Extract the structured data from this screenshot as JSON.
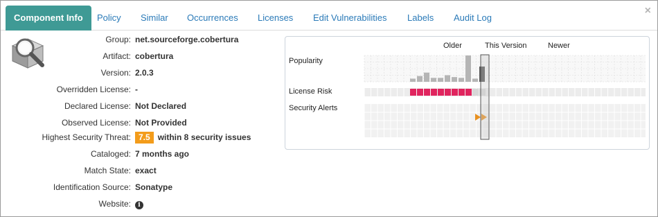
{
  "tabs": [
    {
      "label": "Component Info",
      "active": true
    },
    {
      "label": "Policy"
    },
    {
      "label": "Similar"
    },
    {
      "label": "Occurrences"
    },
    {
      "label": "Licenses"
    },
    {
      "label": "Edit Vulnerabilities"
    },
    {
      "label": "Labels"
    },
    {
      "label": "Audit Log"
    }
  ],
  "close_label": "×",
  "info": {
    "group": {
      "label": "Group:",
      "value": "net.sourceforge.cobertura"
    },
    "artifact": {
      "label": "Artifact:",
      "value": "cobertura"
    },
    "version": {
      "label": "Version:",
      "value": "2.0.3"
    },
    "overridden_license": {
      "label": "Overridden License:",
      "value": "-"
    },
    "declared_license": {
      "label": "Declared License:",
      "value": "Not Declared"
    },
    "observed_license": {
      "label": "Observed License:",
      "value": "Not Provided"
    },
    "highest_threat": {
      "label": "Highest Security Threat:",
      "score": "7.5",
      "suffix": "within 8 security issues"
    },
    "cataloged": {
      "label": "Cataloged:",
      "value": "7 months ago"
    },
    "match_state": {
      "label": "Match State:",
      "value": "exact"
    },
    "identification_source": {
      "label": "Identification Source:",
      "value": "Sonatype"
    },
    "website": {
      "label": "Website:",
      "icon": "info-circle-icon",
      "icon_glyph": "i"
    }
  },
  "chart": {
    "header": {
      "older": "Older",
      "this_version": "This Version",
      "newer": "Newer"
    },
    "rows": {
      "popularity": "Popularity",
      "license_risk": "License Risk",
      "security_alerts": "Security Alerts"
    },
    "colors": {
      "risk": "#e0245e",
      "alert": "#e8901f",
      "bar": "#b5b5b5",
      "bar_current": "#555555",
      "grid": "#dcdcdc"
    },
    "popularity": [
      0.12,
      0.22,
      0.35,
      0.15,
      0.15,
      0.25,
      0.18,
      0.15,
      1.0,
      0.12,
      0.58
    ],
    "current_index": 10,
    "license_risk_count": 9,
    "security_alert_count": 2
  }
}
